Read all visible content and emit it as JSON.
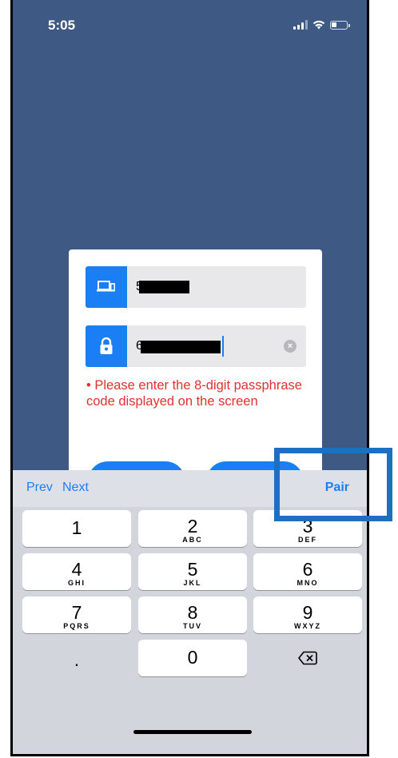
{
  "status_bar": {
    "time": "5:05"
  },
  "dialog": {
    "device_field": {
      "value": "5",
      "icon": "device-icon"
    },
    "passcode_field": {
      "value": "6",
      "icon": "lock-icon"
    },
    "error_text": "• Please enter the 8-digit passphrase code displayed on the screen"
  },
  "keyboard": {
    "toolbar": {
      "prev": "Prev",
      "next": "Next",
      "pair": "Pair"
    },
    "keys": [
      {
        "digit": "1",
        "letters": ""
      },
      {
        "digit": "2",
        "letters": "ABC"
      },
      {
        "digit": "3",
        "letters": "DEF"
      },
      {
        "digit": "4",
        "letters": "GHI"
      },
      {
        "digit": "5",
        "letters": "JKL"
      },
      {
        "digit": "6",
        "letters": "MNO"
      },
      {
        "digit": "7",
        "letters": "PQRS"
      },
      {
        "digit": "8",
        "letters": "TUV"
      },
      {
        "digit": "9",
        "letters": "WXYZ"
      },
      {
        "digit": "0",
        "letters": ""
      }
    ],
    "decimal": ".",
    "backspace_icon": "backspace-icon"
  },
  "colors": {
    "accent": "#1a7ef5",
    "error": "#e0312f",
    "highlight": "#1d6fc2",
    "backdrop": "#3e5a84"
  }
}
